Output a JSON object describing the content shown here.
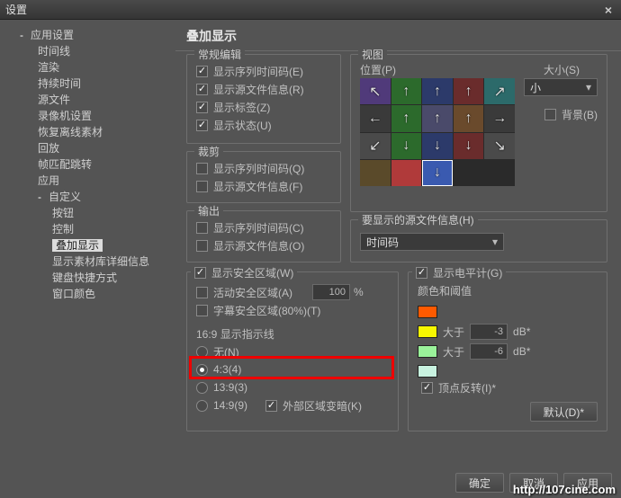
{
  "title": "设置",
  "sidebar": {
    "items": [
      {
        "label": "应用设置",
        "exp": "-"
      },
      {
        "label": "时间线"
      },
      {
        "label": "渲染"
      },
      {
        "label": "持续时间"
      },
      {
        "label": "源文件"
      },
      {
        "label": "录像机设置"
      },
      {
        "label": "恢复离线素材"
      },
      {
        "label": "回放"
      },
      {
        "label": "帧匹配跳转"
      },
      {
        "label": "应用"
      },
      {
        "label": "自定义",
        "exp": "-"
      },
      {
        "label": "按钮"
      },
      {
        "label": "控制"
      },
      {
        "label": "叠加显示"
      },
      {
        "label": "显示素材库详细信息"
      },
      {
        "label": "键盘快捷方式"
      },
      {
        "label": "窗口颜色"
      }
    ]
  },
  "panel_title": "叠加显示",
  "groups": {
    "normal": {
      "label": "常规编辑",
      "items": [
        "显示序列时间码(E)",
        "显示源文件信息(R)",
        "显示标签(Z)",
        "显示状态(U)"
      ]
    },
    "crop": {
      "label": "裁剪",
      "items": [
        "显示序列时间码(Q)",
        "显示源文件信息(F)"
      ]
    },
    "output": {
      "label": "输出",
      "items": [
        "显示序列时间码(C)",
        "显示源文件信息(O)"
      ]
    },
    "view": {
      "label": "视图",
      "pos": "位置(P)",
      "size_label": "大小(S)",
      "size_value": "小",
      "bg": "背景(B)"
    },
    "srcinfo": {
      "label": "要显示的源文件信息(H)",
      "value": "时间码"
    },
    "safe": {
      "show": "显示安全区域(W)",
      "action": "活动安全区域(A)",
      "caption": "字幕安全区域(80%)(T)",
      "pct": "100",
      "pct_suffix": "%",
      "guide": "16:9 显示指示线",
      "opts": [
        "无(N)",
        "4:3(4)",
        "13:9(3)",
        "14:9(9)"
      ],
      "dim": "外部区域变暗(K)"
    },
    "level": {
      "show": "显示电平计(G)",
      "threshold": "颜色和阈值",
      "gt": "大于",
      "v1": "-3",
      "v2": "-6",
      "db": "dB*",
      "invert": "顶点反转(I)*"
    }
  },
  "buttons": {
    "default": "默认(D)*",
    "ok": "确定",
    "cancel": "取消",
    "apply": "应用"
  },
  "watermark": "http://107cine.com",
  "colors": {
    "orange": "#ff5a00",
    "yellow": "#f7f700",
    "green": "#9af29a"
  },
  "viewgrid": {
    "bg": [
      "#503a7a",
      "#2c6a2c",
      "#2c3a6a",
      "#6a2c2c",
      "#2c6a6a"
    ]
  }
}
